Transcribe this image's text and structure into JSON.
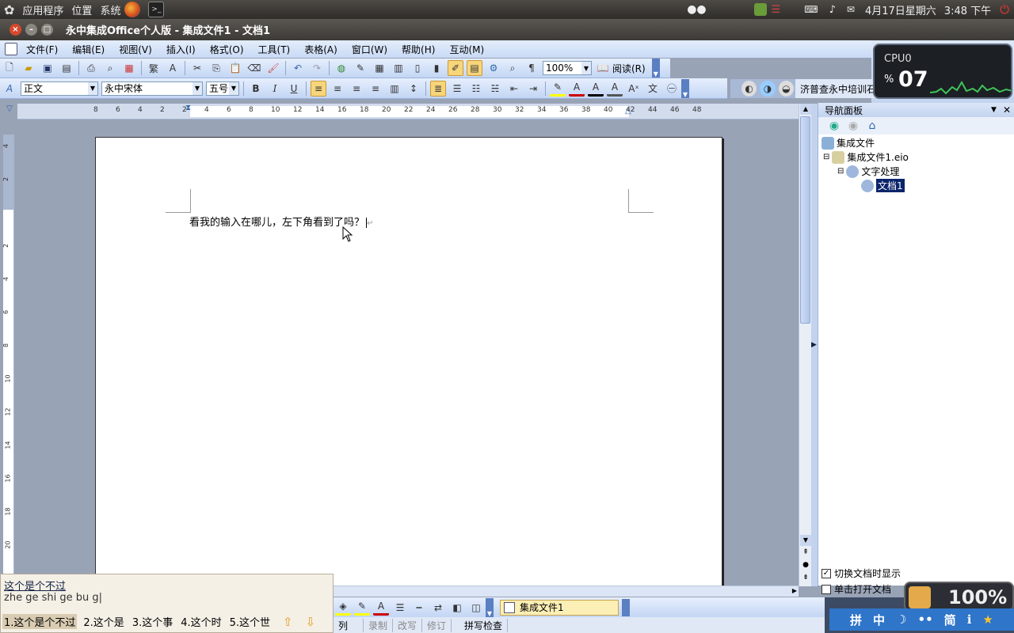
{
  "gnome_panel": {
    "menus": [
      "应用程序",
      "位置",
      "系统"
    ],
    "datetime": "4月17日星期六",
    "time": "3:48 下午"
  },
  "window": {
    "title": "永中集成Office个人版 - 集成文件1 - 文档1"
  },
  "menu": [
    "文件(F)",
    "编辑(E)",
    "视图(V)",
    "插入(I)",
    "格式(O)",
    "工具(T)",
    "表格(A)",
    "窗口(W)",
    "帮助(H)",
    "互动(M)"
  ],
  "toolbar": {
    "zoom": "100%",
    "read_label": "阅读(R)"
  },
  "format_bar": {
    "style": "正文",
    "font": "永中宋体",
    "size": "五号"
  },
  "marquee": "济普查永中培训石",
  "cpu_widget": {
    "label": "CPU0",
    "percent_symbol": "%",
    "value": "07"
  },
  "ruler": {
    "labels": [
      "8",
      "6",
      "4",
      "2",
      "2",
      "4",
      "6",
      "8",
      "10",
      "12",
      "14",
      "16",
      "18",
      "20",
      "22",
      "24",
      "26",
      "28",
      "30",
      "32",
      "34",
      "36",
      "38",
      "40",
      "42",
      "44",
      "46",
      "48"
    ],
    "vlabels": [
      "4",
      "2",
      "2",
      "4",
      "6",
      "8",
      "10",
      "12",
      "14",
      "16",
      "18",
      "20"
    ]
  },
  "document": {
    "text": "看我的输入在哪儿，左下角看到了吗？"
  },
  "nav_panel": {
    "title": "导航面板",
    "root": "集成文件",
    "file": "集成文件1.eio",
    "module": "文字处理",
    "doc": "文档1",
    "opt1": "切换文档时显示",
    "opt2": "单击打开文档"
  },
  "ime": {
    "composition": "这个是个不过",
    "pinyin": "zhe ge shi ge bu g|",
    "candidates": [
      "1.这个是个不过",
      "2.这个是",
      "3.这个事",
      "4.这个时",
      "5.这个世"
    ]
  },
  "bottom_tab": "集成文件1",
  "status": [
    "列",
    "录制",
    "改写",
    "修订",
    "拼写检查"
  ],
  "tray": {
    "battery_text": "100%",
    "ime_icons": [
      "拼",
      "中",
      "简"
    ]
  },
  "colors": {
    "toolbar_blue": "#c9daf5",
    "workspace": "#99a3b6",
    "panel_dark": "#3c3a36"
  }
}
